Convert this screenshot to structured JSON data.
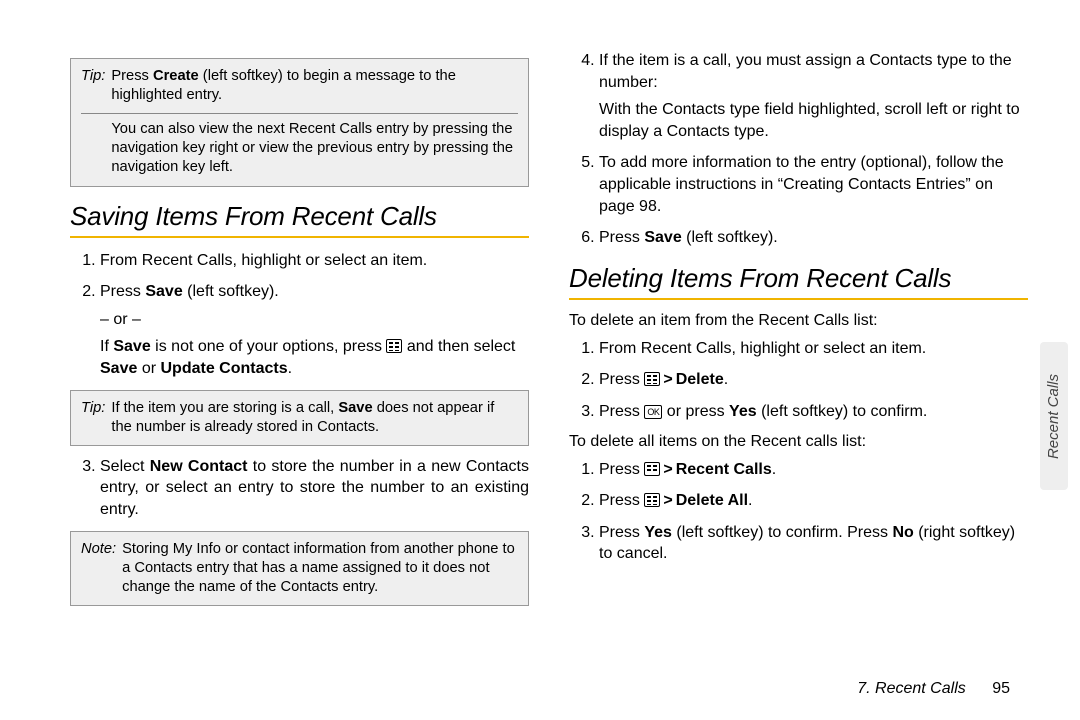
{
  "left": {
    "tip1": {
      "label": "Tip:",
      "line1_pre": "Press ",
      "line1_bold": "Create",
      "line1_post": " (left softkey) to begin a message to the highlighted entry.",
      "line2": "You can also view the next Recent Calls entry by pressing the navigation key right or view the previous entry by pressing the navigation key left."
    },
    "h_save": "Saving Items From Recent Calls",
    "s1": "From Recent Calls, highlight or select an item.",
    "s2_pre": "Press ",
    "s2_bold": "Save",
    "s2_post": " (left softkey).",
    "s2_or": "– or –",
    "s2_if_a": "If ",
    "s2_if_b": "Save",
    "s2_if_c": " is not one of your options, press ",
    "s2_if_d": " and then select ",
    "s2_if_e": "Save",
    "s2_if_f": " or ",
    "s2_if_g": "Update Contacts",
    "s2_if_h": ".",
    "tip2": {
      "label": "Tip:",
      "a": "If the item you are storing is a call, ",
      "b": "Save",
      "c": " does not appear if the number is already stored in Contacts."
    },
    "s3_a": "Select ",
    "s3_b": "New Contact",
    "s3_c": " to store the number in a new Contacts entry, or select an entry to store the number to an existing entry.",
    "note": {
      "label": "Note:",
      "text": "Storing My Info or contact information from another phone to a Contacts entry that has a name assigned to it does not change the name of the Contacts entry."
    }
  },
  "right": {
    "s4": "If the item is a call, you must assign a Contacts type to the number:",
    "s4b": "With the Contacts type field highlighted, scroll left or right to display a Contacts type.",
    "s5": "To add more information to the entry (optional), follow the applicable instructions in “Creating Contacts Entries” on page 98.",
    "s6_a": "Press ",
    "s6_b": "Save",
    "s6_c": " (left softkey).",
    "h_del": "Deleting Items From Recent Calls",
    "lead1": "To delete an item from the Recent Calls list:",
    "d1": "From Recent Calls, highlight or select an item.",
    "d2_a": "Press ",
    "d2_b": "Delete",
    "d2_c": ".",
    "d3_a": "Press ",
    "d3_b": " or press ",
    "d3_c": "Yes",
    "d3_d": " (left softkey) to confirm.",
    "lead2": "To delete all items on the Recent calls list:",
    "e1_a": "Press ",
    "e1_b": "Recent Calls",
    "e1_c": ".",
    "e2_a": "Press ",
    "e2_b": "Delete All",
    "e2_c": ".",
    "e3_a": "Press ",
    "e3_b": "Yes",
    "e3_c": " (left softkey) to confirm. Press ",
    "e3_d": "No",
    "e3_e": " (right softkey) to cancel."
  },
  "ok_label": "OK",
  "footer_section": "7. Recent Calls",
  "footer_page": "95",
  "side_tab": "Recent Calls"
}
